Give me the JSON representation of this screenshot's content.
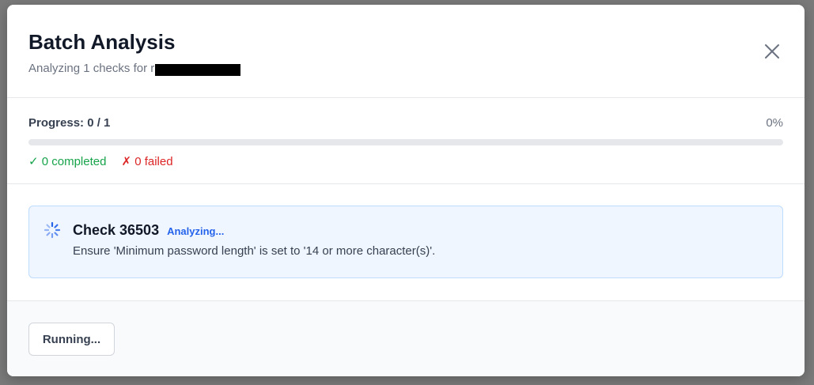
{
  "modal": {
    "title": "Batch Analysis",
    "subtitle": "Analyzing 1 checks for r",
    "close_icon": "close-icon"
  },
  "progress": {
    "label": "Progress: 0 / 1",
    "percent_text": "0%",
    "fraction": 0,
    "completed_text": "✓ 0 completed",
    "failed_text": "✗ 0 failed"
  },
  "checks": [
    {
      "title": "Check 36503",
      "status": "Analyzing...",
      "description": "Ensure 'Minimum password length' is set to '14 or more character(s)'.",
      "icon": "spinner-icon"
    }
  ],
  "footer": {
    "running_label": "Running..."
  },
  "colors": {
    "accent": "#2563eb",
    "success": "#16a34a",
    "danger": "#dc2626",
    "card_bg": "#eff6ff"
  }
}
